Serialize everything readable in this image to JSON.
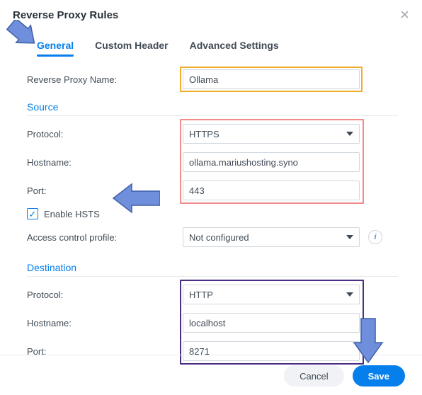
{
  "dialog": {
    "title": "Reverse Proxy Rules",
    "close_aria": "Close"
  },
  "tabs": {
    "general": "General",
    "custom_header": "Custom Header",
    "advanced": "Advanced Settings"
  },
  "fields": {
    "name_label": "Reverse Proxy Name:",
    "name_value": "Ollama"
  },
  "source": {
    "title": "Source",
    "protocol_label": "Protocol:",
    "protocol_value": "HTTPS",
    "hostname_label": "Hostname:",
    "hostname_value": "ollama.mariushosting.syno",
    "port_label": "Port:",
    "port_value": "443",
    "hsts_label": "Enable HSTS",
    "hsts_checked": true,
    "acp_label": "Access control profile:",
    "acp_value": "Not configured"
  },
  "destination": {
    "title": "Destination",
    "protocol_label": "Protocol:",
    "protocol_value": "HTTP",
    "hostname_label": "Hostname:",
    "hostname_value": "localhost",
    "port_label": "Port:",
    "port_value": "8271"
  },
  "footer": {
    "cancel": "Cancel",
    "save": "Save"
  },
  "annotation_color": "#6f8fdc"
}
